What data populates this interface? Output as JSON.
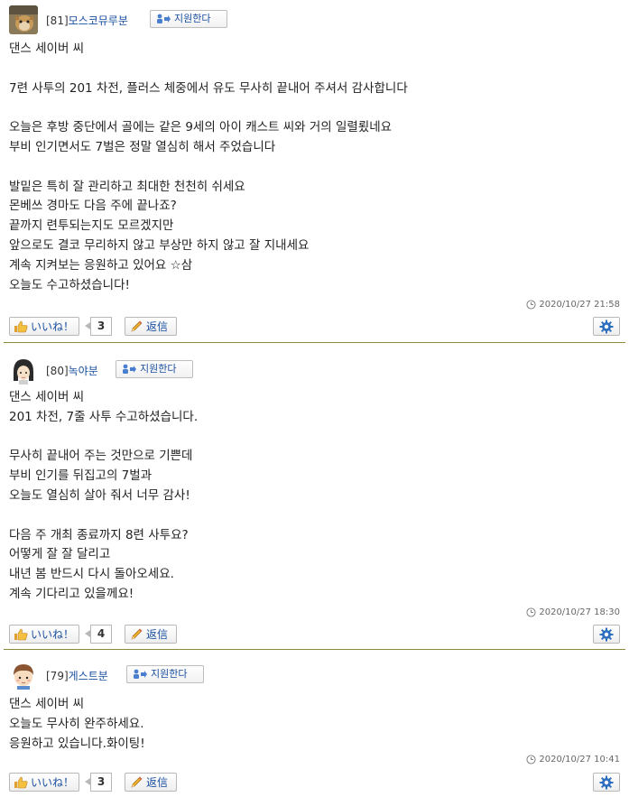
{
  "posts": [
    {
      "number": "[81]",
      "author": "모스코뮤루분",
      "support_label": "지원한다",
      "lines": [
        "댄스 세이버 씨",
        "",
        "7련 사투의 201 차전, 플러스 체중에서 유도 무사히 끝내어 주셔서 감사합니다",
        "",
        "오늘은 후방 중단에서 골에는 같은 9세의 아이 캐스트 씨와 거의 일렬룄네요",
        "부비 인기면서도 7벌은 정말 열심히 해서 주었습니다",
        "",
        "발밑은 특히 잘 관리하고 최대한 천천히 쉬세요",
        "몬베쓰 경마도 다음 주에 끝나죠?",
        "끝까지 련투되는지도 모르겠지만",
        "앞으로도 결코 무리하지 않고 부상만 하지 않고 잘 지내세요",
        "계속 지켜보는 응원하고 있어요 ☆삼",
        "오늘도 수고하셨습니다!"
      ],
      "timestamp": "2020/10/27 21:58",
      "like_label": "いいね！",
      "like_count": "3",
      "reply_label": "返信"
    },
    {
      "number": "[80]",
      "author": "녹야분",
      "support_label": "지원한다",
      "lines": [
        "댄스 세이버 씨",
        "201 차전, 7줄 사투 수고하셨습니다.",
        "",
        "무사히 끝내어 주는 것만으로 기쁜데",
        "부비 인기를 뒤집고의 7벌과",
        "오늘도 열심히 살아 줘서 너무 감사!",
        "",
        "다음 주 개최 종료까지 8련 사투요?",
        "어떻게 잘 잘 달리고",
        "내년 봄 반드시 다시 돌아오세요.",
        "계속 기다리고 있을께요!"
      ],
      "timestamp": "2020/10/27 18:30",
      "like_label": "いいね！",
      "like_count": "4",
      "reply_label": "返信"
    },
    {
      "number": "[79]",
      "author": "게스트분",
      "support_label": "지원한다",
      "lines": [
        "댄스 세이버 씨",
        "오늘도 무사히 완주하세요.",
        "응원하고 있습니다.화이팅!"
      ],
      "timestamp": "2020/10/27 10:41",
      "like_label": "いいね！",
      "like_count": "3",
      "reply_label": "返信"
    }
  ],
  "icons": {
    "support": "support-person-arrow-icon",
    "clock": "clock-icon",
    "like": "thumbs-up-icon",
    "reply": "pencil-icon",
    "settings": "gear-icon"
  },
  "colors": {
    "link": "#1a4fa0",
    "divider": "#8a8a3a"
  }
}
